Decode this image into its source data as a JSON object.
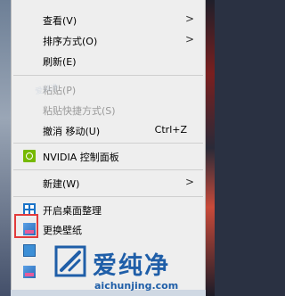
{
  "menu": {
    "items": [
      {
        "label": "查看(V)",
        "submenu": true
      },
      {
        "label": "排序方式(O)",
        "submenu": true
      },
      {
        "label": "刷新(E)"
      },
      {
        "label": "粘贴(P)",
        "disabled": true
      },
      {
        "label": "粘贴快捷方式(S)",
        "disabled": true
      },
      {
        "label": "撤消 移动(U)",
        "shortcut": "Ctrl+Z"
      },
      {
        "label": "NVIDIA 控制面板",
        "icon": "nvidia-icon"
      },
      {
        "label": "新建(W)",
        "submenu": true
      },
      {
        "label": "开启桌面整理",
        "icon": "desktop-organize-icon"
      },
      {
        "label": "更换壁纸",
        "icon": "wallpaper-icon"
      }
    ],
    "submenu_arrow": ">",
    "highlight_color": "#e23b3b"
  },
  "watermark": {
    "logo_text": "爱纯净",
    "url": "aichunjing.com",
    "faint_text": "爱纯净"
  }
}
